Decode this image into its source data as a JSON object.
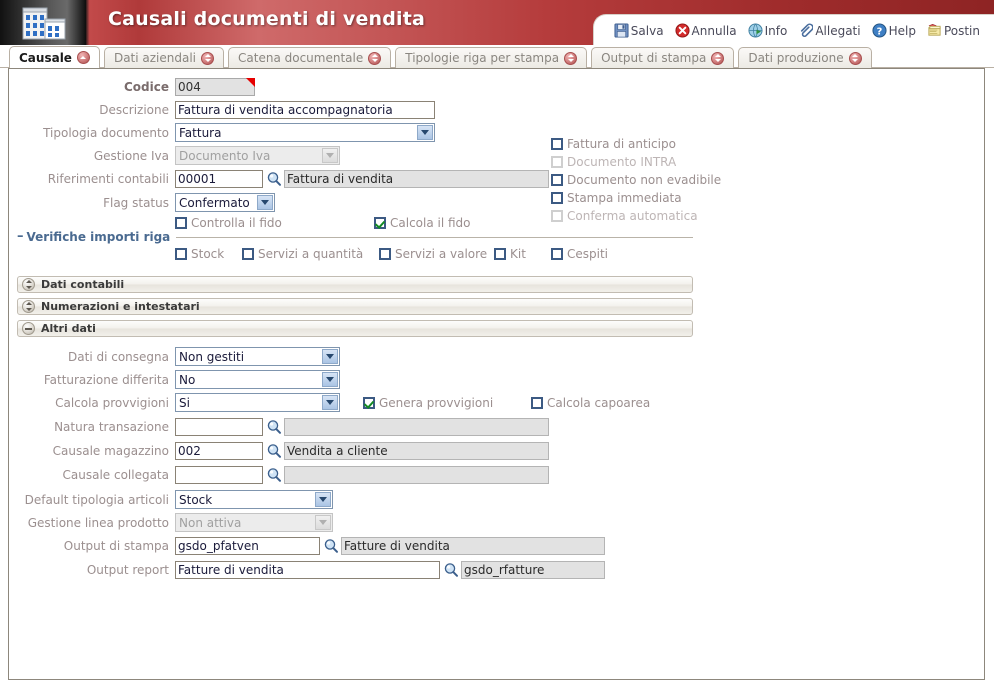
{
  "window": {
    "title": "Causali documenti di vendita",
    "app_icon": "building-icon"
  },
  "toolbar": {
    "items": [
      {
        "label": "Salva",
        "icon": "save-icon"
      },
      {
        "label": "Annulla",
        "icon": "cancel-icon"
      },
      {
        "label": "Info",
        "icon": "info-icon"
      },
      {
        "label": "Allegati",
        "icon": "attachment-icon"
      },
      {
        "label": "Help",
        "icon": "help-icon"
      },
      {
        "label": "Postin",
        "icon": "postit-icon"
      }
    ]
  },
  "tabs": [
    {
      "label": "Causale",
      "active": true,
      "badge": "chevron-up-icon"
    },
    {
      "label": "Dati aziendali",
      "active": false,
      "badge": "chevron-down-icon"
    },
    {
      "label": "Catena documentale",
      "active": false,
      "badge": "chevron-down-icon"
    },
    {
      "label": "Tipologie riga per stampa",
      "active": false,
      "badge": "chevron-down-icon"
    },
    {
      "label": "Output di stampa",
      "active": false,
      "badge": "chevron-down-icon"
    },
    {
      "label": "Dati produzione",
      "active": false,
      "badge": "chevron-down-icon"
    }
  ],
  "causale": {
    "codice": {
      "label": "Codice",
      "value": "004",
      "readonly": true,
      "marker": "red-corner-marker"
    },
    "descrizione": {
      "label": "Descrizione",
      "value": "Fattura di vendita accompagnatoria"
    },
    "tipologia_documento": {
      "label": "Tipologia documento",
      "value": "Fattura",
      "disabled": false
    },
    "gestione_iva": {
      "label": "Gestione Iva",
      "value": "Documento Iva",
      "disabled": true
    },
    "riferimenti_contabili": {
      "label": "Riferimenti contabili",
      "code": "00001",
      "description": "Fattura di vendita",
      "lookup_icon": "magnifier-icon"
    },
    "flag_status": {
      "label": "Flag status",
      "value": "Confermato",
      "disabled": false
    },
    "controlla_fido": {
      "label": "Controlla il fido",
      "checked": false,
      "disabled": false
    },
    "calcola_fido": {
      "label": "Calcola il fido",
      "checked": true,
      "disabled": false
    },
    "right_checks": [
      {
        "label": "Fattura di anticipo",
        "checked": false,
        "disabled": false
      },
      {
        "label": "Documento INTRA",
        "checked": false,
        "disabled": true
      },
      {
        "label": "Documento non evadibile",
        "checked": false,
        "disabled": false
      },
      {
        "label": "Stampa immediata",
        "checked": false,
        "disabled": false
      },
      {
        "label": "Conferma automatica",
        "checked": false,
        "disabled": true
      }
    ],
    "cespiti": {
      "label": "Cespiti",
      "checked": false,
      "disabled": false
    },
    "verifiche_importi_riga": {
      "legend": "Verifiche importi riga",
      "toggle": "–",
      "items": [
        {
          "label": "Stock",
          "checked": false
        },
        {
          "label": "Servizi a quantità",
          "checked": false
        },
        {
          "label": "Servizi a valore",
          "checked": false
        },
        {
          "label": "Kit",
          "checked": false
        }
      ]
    }
  },
  "sections": [
    {
      "label": "Dati contabili",
      "state": "collapsed",
      "icon": "expand-icon"
    },
    {
      "label": "Numerazioni e intestatari",
      "state": "collapsed",
      "icon": "expand-icon"
    },
    {
      "label": "Altri dati",
      "state": "expanded",
      "icon": "collapse-icon"
    }
  ],
  "altri_dati": {
    "dati_di_consegna": {
      "label": "Dati di consegna",
      "value": "Non gestiti",
      "disabled": false
    },
    "fatturazione_differita": {
      "label": "Fatturazione differita",
      "value": "No",
      "disabled": false
    },
    "calcola_provvigioni": {
      "label": "Calcola provvigioni",
      "value": "Si",
      "disabled": false
    },
    "genera_provvigioni": {
      "label": "Genera provvigioni",
      "checked": true,
      "disabled": false
    },
    "calcola_capoarea": {
      "label": "Calcola capoarea",
      "checked": false,
      "disabled": false
    },
    "natura_transazione": {
      "label": "Natura transazione",
      "code": "",
      "description": "",
      "lookup_icon": "magnifier-icon"
    },
    "causale_magazzino": {
      "label": "Causale magazzino",
      "code": "002",
      "description": "Vendita a cliente",
      "lookup_icon": "magnifier-icon"
    },
    "causale_collegata": {
      "label": "Causale collegata",
      "code": "",
      "description": "",
      "lookup_icon": "magnifier-icon"
    },
    "default_tipologia_articoli": {
      "label": "Default tipologia articoli",
      "value": "Stock",
      "disabled": false
    },
    "gestione_linea_prodotto": {
      "label": "Gestione linea prodotto",
      "value": "Non attiva",
      "disabled": true
    },
    "output_di_stampa": {
      "label": "Output di stampa",
      "code": "gsdo_pfatven",
      "description": "Fatture di vendita",
      "lookup_icon": "magnifier-icon"
    },
    "output_report": {
      "label": "Output report",
      "code": "Fatture di vendita",
      "description": "gsdo_rfatture",
      "lookup_icon": "magnifier-icon"
    }
  },
  "colors": {
    "title_red": "#b03a3a",
    "label_grey": "#9b8f8f",
    "input_border": "#8a8275",
    "select_border": "#7f95ae",
    "checkbox_border": "#3c5a83",
    "check_green": "#128a24",
    "legend_blue": "#4a6a90",
    "marker_red": "#e60000"
  }
}
